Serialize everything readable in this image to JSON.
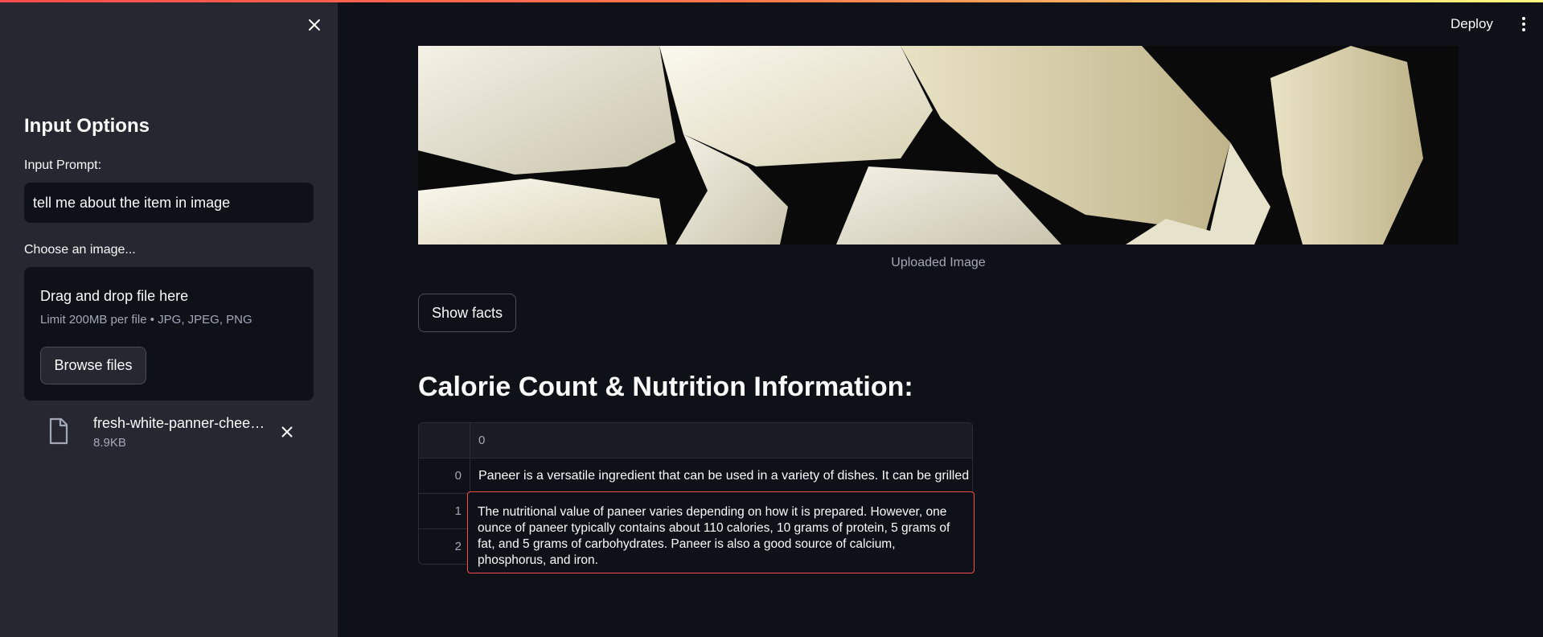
{
  "sidebar": {
    "title": "Input Options",
    "prompt_label": "Input Prompt:",
    "prompt_value": "tell me about the item in image",
    "upload_label": "Choose an image...",
    "dropzone_title": "Drag and drop file here",
    "dropzone_limit": "Limit 200MB per file • JPG, JPEG, PNG",
    "browse_label": "Browse files",
    "file": {
      "name": "fresh-white-panner-chee…",
      "size": "8.9KB"
    }
  },
  "header": {
    "deploy_label": "Deploy"
  },
  "main": {
    "image_caption": "Uploaded Image",
    "show_facts_label": "Show facts",
    "heading": "Calorie Count & Nutrition Information:",
    "table": {
      "column_header": "0",
      "rows": [
        {
          "index": "0",
          "value": "Paneer is a versatile ingredient that can be used in a variety of dishes. It can be grilled"
        },
        {
          "index": "1",
          "value": ""
        },
        {
          "index": "2",
          "value": ""
        }
      ],
      "expanded_cell": "The nutritional value of paneer varies depending on how it is prepared. However, one ounce of paneer typically contains about 110 calories, 10 grams of protein, 5 grams of fat, and 5 grams of carbohydrates. Paneer is also a good source of calcium, phosphorus, and iron."
    }
  },
  "colors": {
    "background": "#0e1117",
    "sidebar": "#262730",
    "accent": "#ff4b4b"
  }
}
